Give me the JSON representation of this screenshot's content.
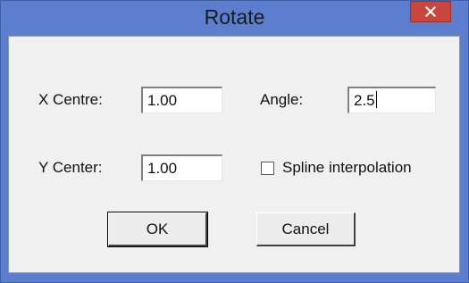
{
  "window": {
    "title": "Rotate",
    "close_icon": "close-icon",
    "colors": {
      "titlebar": "#5b7fce",
      "close_button": "#c9463d",
      "client": "#f0f0f0"
    }
  },
  "form": {
    "x_centre_label": "X Centre:",
    "x_centre_value": "1.00",
    "angle_label": "Angle:",
    "angle_value": "2.5",
    "y_center_label": "Y Center:",
    "y_center_value": "1.00",
    "spline_label": "Spline interpolation",
    "spline_checked": false
  },
  "buttons": {
    "ok_label": "OK",
    "cancel_label": "Cancel"
  }
}
